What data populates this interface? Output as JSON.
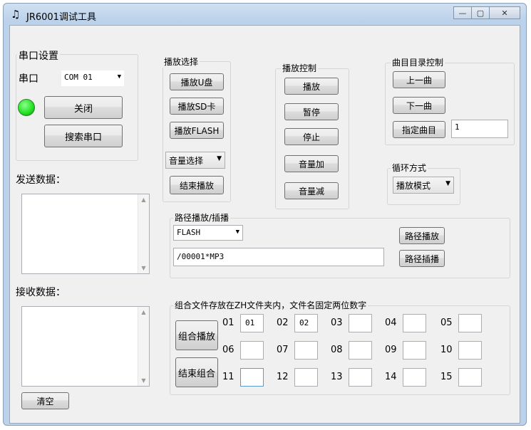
{
  "window": {
    "title": "JR6001调试工具",
    "icon": "music-note-icon",
    "minimize": "—",
    "maximize": "▢",
    "close": "✕"
  },
  "serial": {
    "group_label": "串口设置",
    "port_label": "串口",
    "port_value": "COM 01",
    "status_color": "#1fe11f",
    "close_button": "关闭",
    "search_button": "搜索串口"
  },
  "send": {
    "label": "发送数据："
  },
  "receive": {
    "label": "接收数据："
  },
  "clear_button": "清空",
  "play_select": {
    "group_label": "播放选择",
    "udisk_button": "播放U盘",
    "sd_button": "播放SD卡",
    "flash_button": "播放FLASH",
    "volume_select": "音量选择",
    "stop_button": "结束播放"
  },
  "play_control": {
    "group_label": "播放控制",
    "play_button": "播放",
    "pause_button": "暂停",
    "stop_button": "停止",
    "vol_up_button": "音量加",
    "vol_down_button": "音量减"
  },
  "track_control": {
    "group_label": "曲目目录控制",
    "prev_button": "上一曲",
    "next_button": "下一曲",
    "specify_button": "指定曲目",
    "specify_value": "1"
  },
  "loop": {
    "group_label": "循环方式",
    "mode_value": "播放模式"
  },
  "path_play": {
    "group_label": "路径播放/插播",
    "device_value": "FLASH",
    "path_value": "/00001*MP3",
    "play_button": "路径播放",
    "insert_button": "路径插播"
  },
  "combo_play": {
    "group_label": "组合文件存放在ZH文件夹内，文件名固定两位数字",
    "play_button": "组合播放",
    "end_button": "结束组合",
    "slots": [
      {
        "label": "01",
        "value": "01"
      },
      {
        "label": "02",
        "value": "02"
      },
      {
        "label": "03",
        "value": ""
      },
      {
        "label": "04",
        "value": ""
      },
      {
        "label": "05",
        "value": ""
      },
      {
        "label": "06",
        "value": ""
      },
      {
        "label": "07",
        "value": ""
      },
      {
        "label": "08",
        "value": ""
      },
      {
        "label": "09",
        "value": ""
      },
      {
        "label": "10",
        "value": ""
      },
      {
        "label": "11",
        "value": ""
      },
      {
        "label": "12",
        "value": ""
      },
      {
        "label": "13",
        "value": ""
      },
      {
        "label": "14",
        "value": ""
      },
      {
        "label": "15",
        "value": ""
      }
    ]
  }
}
